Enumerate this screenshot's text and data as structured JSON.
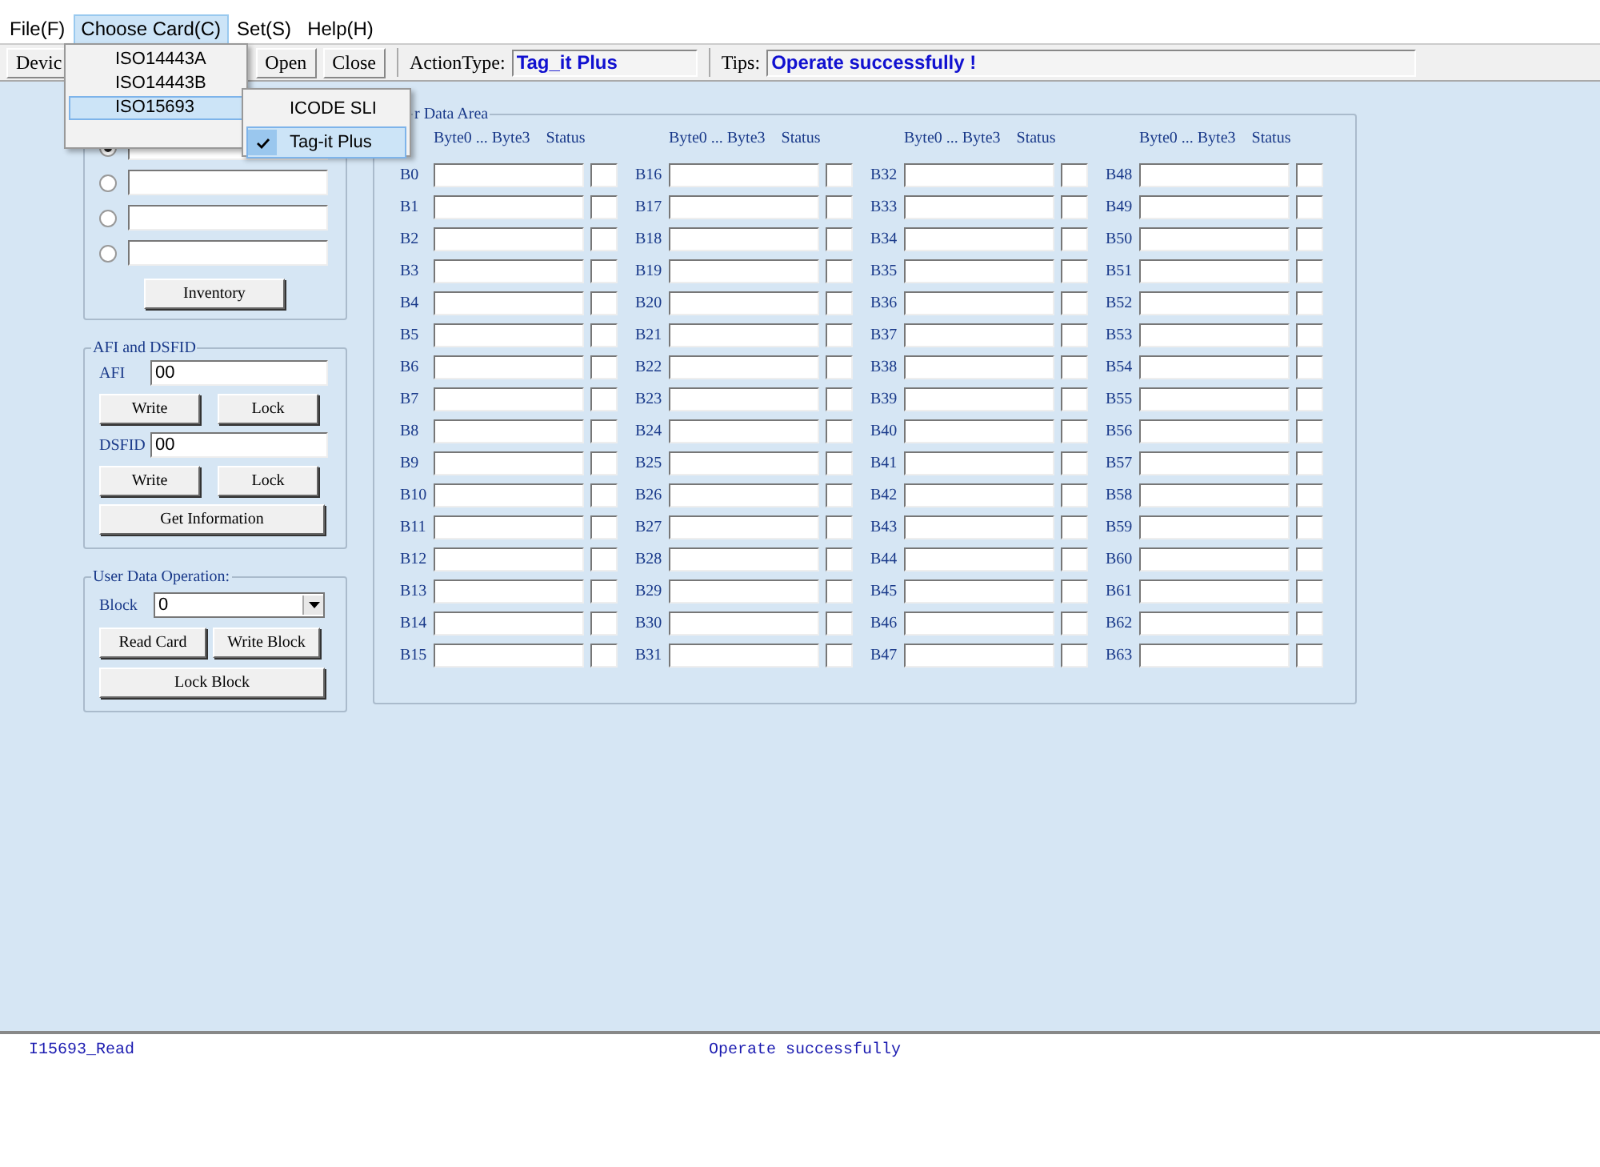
{
  "menu": [
    {
      "label": "File(F)",
      "selected": false
    },
    {
      "label": "Choose Card(C)",
      "selected": true
    },
    {
      "label": "Set(S)",
      "selected": false
    },
    {
      "label": "Help(H)",
      "selected": false
    }
  ],
  "dropdown": {
    "items": [
      {
        "label": "ISO14443A",
        "selected": false
      },
      {
        "label": "ISO14443B",
        "selected": false
      },
      {
        "label": "ISO15693",
        "selected": true
      }
    ]
  },
  "submenu": {
    "items": [
      {
        "label": "ICODE SLI",
        "checked": false,
        "selected": false
      },
      {
        "label": "Tag-it Plus",
        "checked": true,
        "selected": true
      }
    ]
  },
  "toolbar": {
    "buttons": [
      "Devic",
      "Open",
      "Close"
    ],
    "action_type": {
      "label": "ActionType:",
      "value": "Tag_it Plus"
    },
    "tips": {
      "label": "Tips:",
      "value": "Operate successfully !"
    }
  },
  "inventory": {
    "tags": [
      {
        "selected": true
      },
      {
        "selected": false
      },
      {
        "selected": false
      },
      {
        "selected": false
      }
    ],
    "button": "Inventory"
  },
  "afi_dsfid": {
    "title": "AFI and DSFID",
    "afi": {
      "label": "AFI",
      "value": "00"
    },
    "afi_buttons": [
      "Write",
      "Lock"
    ],
    "dsfid": {
      "label": "DSFID",
      "value": "00"
    },
    "dsfid_buttons": [
      "Write",
      "Lock"
    ],
    "info_button": "Get Information"
  },
  "user_data_operation": {
    "title": "User Data Operation:",
    "block": {
      "label": "Block",
      "value": "0"
    },
    "buttons": [
      "Read Card",
      "Write Block",
      "Lock Block"
    ]
  },
  "user_data_area": {
    "title": "r Data Area",
    "columns": [
      {
        "bytes_header": "Byte0 ... Byte3",
        "status_header": "Status",
        "blocks": [
          "B0",
          "B1",
          "B2",
          "B3",
          "B4",
          "B5",
          "B6",
          "B7",
          "B8",
          "B9",
          "B10",
          "B11",
          "B12",
          "B13",
          "B14",
          "B15"
        ]
      },
      {
        "bytes_header": "Byte0 ... Byte3",
        "status_header": "Status",
        "blocks": [
          "B16",
          "B17",
          "B18",
          "B19",
          "B20",
          "B21",
          "B22",
          "B23",
          "B24",
          "B25",
          "B26",
          "B27",
          "B28",
          "B29",
          "B30",
          "B31"
        ]
      },
      {
        "bytes_header": "Byte0 ... Byte3",
        "status_header": "Status",
        "blocks": [
          "B32",
          "B33",
          "B34",
          "B35",
          "B36",
          "B37",
          "B38",
          "B39",
          "B40",
          "B41",
          "B42",
          "B43",
          "B44",
          "B45",
          "B46",
          "B47"
        ]
      },
      {
        "bytes_header": "Byte0 ... Byte3",
        "status_header": "Status",
        "blocks": [
          "B48",
          "B49",
          "B50",
          "B51",
          "B52",
          "B53",
          "B54",
          "B55",
          "B56",
          "B57",
          "B58",
          "B59",
          "B60",
          "B61",
          "B62",
          "B63"
        ]
      }
    ]
  },
  "status_bar": [
    "I15693_Read",
    "Operate successfully"
  ]
}
